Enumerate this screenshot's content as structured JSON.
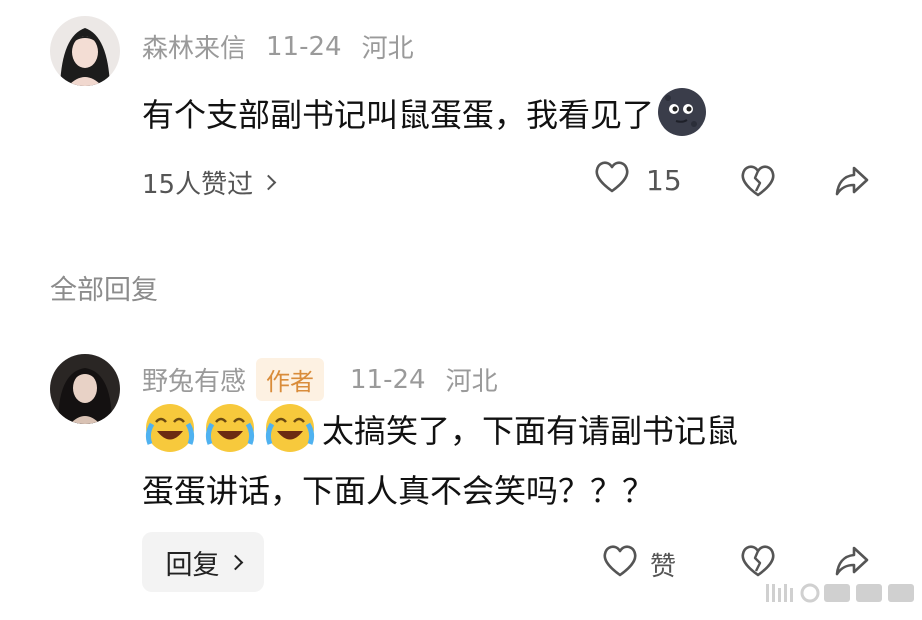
{
  "comment": {
    "username": "森林来信",
    "date": "11-24",
    "location": "河北",
    "text": "有个支部副书记叫鼠蛋蛋，我看见了",
    "text_emoji": "dark-moon-face-emoji",
    "likes_link": "15人赞过",
    "like_count": "15"
  },
  "replies_section": {
    "title": "全部回复"
  },
  "reply": {
    "username": "野兔有感",
    "author_badge": "作者",
    "date": "11-24",
    "location": "河北",
    "emojis": [
      "laughing-crying-emoji",
      "laughing-crying-emoji",
      "laughing-crying-emoji"
    ],
    "text_line1": "太搞笑了，下面有请副书记鼠",
    "text_line2": "蛋蛋讲话，下面人真不会笑吗？？？",
    "reply_button": "回复",
    "like_label": "赞"
  },
  "colors": {
    "meta": "#9a9a9a",
    "badge_bg": "#fdf1e2",
    "badge_text": "#d98c3a",
    "icon": "#555555"
  }
}
